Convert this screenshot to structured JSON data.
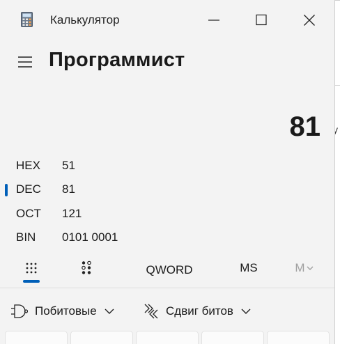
{
  "window": {
    "title": "Калькулятор",
    "icon": "calculator-icon",
    "controls": {
      "minimize": "minimize-icon",
      "maximize": "maximize-icon",
      "close": "close-icon"
    }
  },
  "header": {
    "menu_icon": "hamburger-icon",
    "mode_title": "Программист"
  },
  "display": {
    "value": "81"
  },
  "radix": [
    {
      "label": "HEX",
      "value": "51",
      "selected": false
    },
    {
      "label": "DEC",
      "value": "81",
      "selected": true
    },
    {
      "label": "OCT",
      "value": "121",
      "selected": false
    },
    {
      "label": "BIN",
      "value": "0101 0001",
      "selected": false
    }
  ],
  "toolbar": {
    "full_keypad_icon": "keypad-grid-icon",
    "bit_toggle_icon": "bit-toggle-keypad-icon",
    "word_size": "QWORD",
    "memory_store": "MS",
    "memory_list": "M"
  },
  "bitwise": {
    "bitwise_label": "Побитовые",
    "bitwise_icon": "logic-gate-icon",
    "bitshift_label": "Сдвиг битов",
    "bitshift_icon": "bit-shift-icon"
  },
  "peek_text": "у",
  "colors": {
    "accent": "#005fb8",
    "background": "#f3f3f3",
    "text": "#1a1a1a"
  }
}
